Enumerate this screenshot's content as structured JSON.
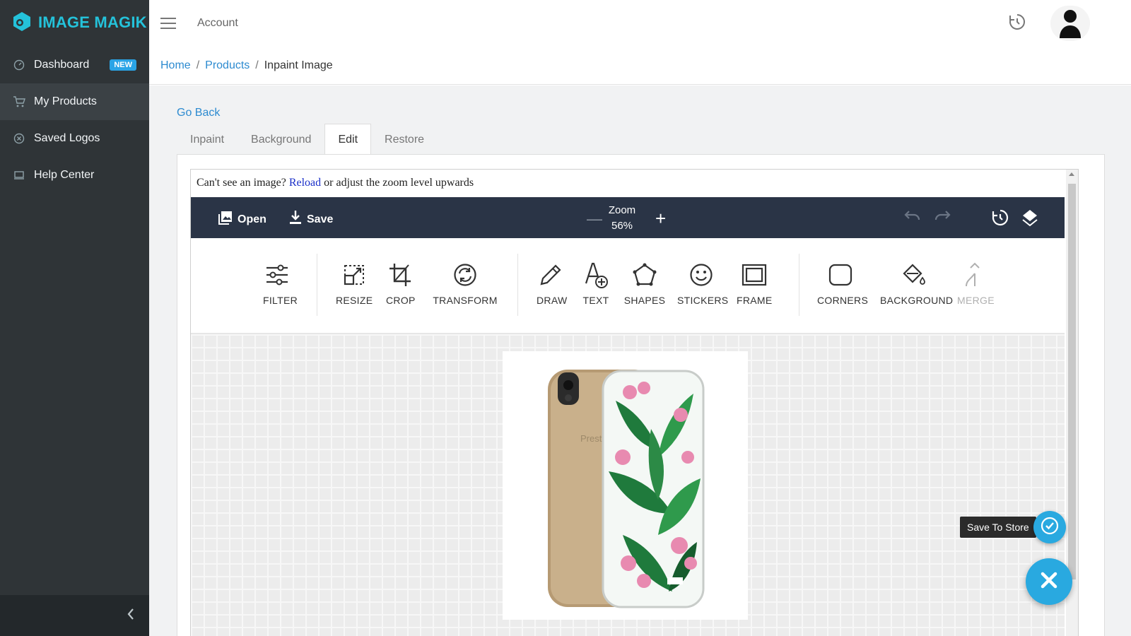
{
  "brand": {
    "name": "IMAGE MAGIK",
    "color": "#24c2da"
  },
  "sidebar": {
    "items": [
      {
        "label": "Dashboard",
        "icon": "dashboard-gauge-icon",
        "badge": "NEW"
      },
      {
        "label": "My Products",
        "icon": "cart-icon",
        "active": true
      },
      {
        "label": "Saved Logos",
        "icon": "circle-x-icon"
      },
      {
        "label": "Help Center",
        "icon": "monitor-icon"
      }
    ],
    "collapse_icon": "chevron-left-icon"
  },
  "topbar": {
    "account_label": "Account",
    "history_icon": "clock-history-icon",
    "avatar_icon": "user-avatar-icon"
  },
  "breadcrumb": {
    "home": "Home",
    "products": "Products",
    "current": "Inpaint Image",
    "separator": "/"
  },
  "main": {
    "go_back": "Go Back",
    "tabs": [
      {
        "label": "Inpaint"
      },
      {
        "label": "Background"
      },
      {
        "label": "Edit",
        "active": true
      },
      {
        "label": "Restore"
      }
    ]
  },
  "editor": {
    "notice": {
      "prefix": "Can't see an image?",
      "link": "Reload",
      "suffix": "or adjust the zoom level upwards"
    },
    "toolbar": {
      "open_label": "Open",
      "save_label": "Save",
      "zoom_label": "Zoom",
      "zoom_value": "56%"
    },
    "tools": [
      {
        "label": "FILTER",
        "icon": "sliders-icon"
      },
      {
        "label": "RESIZE",
        "icon": "resize-icon"
      },
      {
        "label": "CROP",
        "icon": "crop-icon"
      },
      {
        "label": "TRANSFORM",
        "icon": "transform-icon"
      },
      {
        "label": "DRAW",
        "icon": "pencil-icon"
      },
      {
        "label": "TEXT",
        "icon": "text-add-icon"
      },
      {
        "label": "SHAPES",
        "icon": "pentagon-icon"
      },
      {
        "label": "STICKERS",
        "icon": "smiley-icon"
      },
      {
        "label": "FRAME",
        "icon": "frame-icon"
      },
      {
        "label": "CORNERS",
        "icon": "rounded-square-icon"
      },
      {
        "label": "BACKGROUND",
        "icon": "paint-bucket-icon"
      },
      {
        "label": "MERGE",
        "icon": "merge-icon",
        "disabled": true
      }
    ]
  },
  "actions": {
    "save_to_store": "Save To Store"
  },
  "colors": {
    "accent": "#29a9e0",
    "sidebar_bg": "#2f3437",
    "toolbar_bg": "#2a3446",
    "link": "#2d8bd0"
  }
}
